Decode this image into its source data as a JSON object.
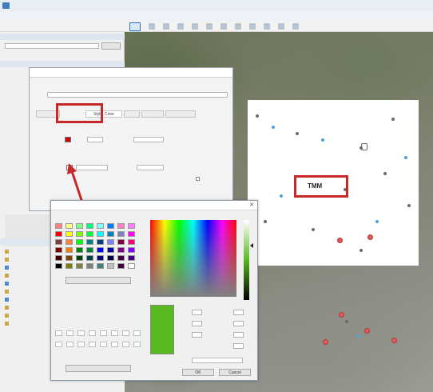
{
  "colors": {
    "accent": "#c62828",
    "selected_color": "#58b820",
    "fill_color": "#cc0000",
    "map_overlay": "#ffffff"
  },
  "map": {
    "label": "TMM"
  },
  "edit_dialog": {
    "tabs": [
      "Style, Color"
    ]
  },
  "color_dialog": {
    "ok_label": "OK",
    "cancel_label": "Cancel"
  },
  "basic_colors": [
    "#ff8080",
    "#ffff80",
    "#80ff80",
    "#00ff80",
    "#80ffff",
    "#0080ff",
    "#ff80c0",
    "#ff80ff",
    "#ff0000",
    "#ffff00",
    "#80ff00",
    "#00ff40",
    "#00ffff",
    "#0080c0",
    "#8080c0",
    "#ff00ff",
    "#804040",
    "#ff8040",
    "#00ff00",
    "#008080",
    "#004080",
    "#8080ff",
    "#800040",
    "#ff0080",
    "#800000",
    "#ff8000",
    "#008000",
    "#008040",
    "#0000ff",
    "#0000a0",
    "#800080",
    "#8000ff",
    "#400000",
    "#804000",
    "#004000",
    "#004040",
    "#000080",
    "#000040",
    "#400040",
    "#400080",
    "#000000",
    "#808000",
    "#808040",
    "#808080",
    "#408080",
    "#c0c0c0",
    "#400040",
    "#ffffff"
  ]
}
